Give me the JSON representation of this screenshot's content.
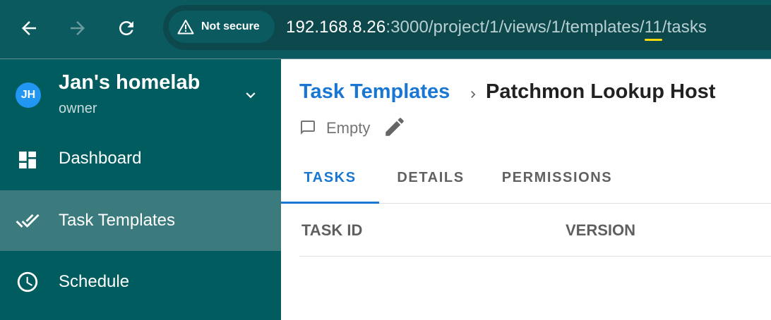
{
  "browser": {
    "security_chip": "Not secure",
    "url": {
      "host": "192.168.8.26",
      "path_before": ":3000/project/1/views/1/templates/",
      "highlighted": "11",
      "path_after": "/tasks"
    },
    "highlight_color": "#f5d90a"
  },
  "sidebar": {
    "project": {
      "initials": "JH",
      "name": "Jan's homelab",
      "role": "owner"
    },
    "items": [
      {
        "label": "Dashboard",
        "icon": "dashboard-icon"
      },
      {
        "label": "Task Templates",
        "icon": "double-check-icon",
        "active": true
      },
      {
        "label": "Schedule",
        "icon": "clock-icon"
      }
    ],
    "colors": {
      "background": "#005c5f",
      "active": "#3b7b7e"
    }
  },
  "main": {
    "breadcrumb": {
      "parent": "Task Templates",
      "current": "Patchmon Lookup Host"
    },
    "description": "Empty",
    "tabs": [
      {
        "label": "TASKS",
        "active": true
      },
      {
        "label": "DETAILS"
      },
      {
        "label": "PERMISSIONS"
      }
    ],
    "table": {
      "headers": [
        "TASK ID",
        "VERSION"
      ]
    },
    "accent_color": "#1976d2"
  }
}
